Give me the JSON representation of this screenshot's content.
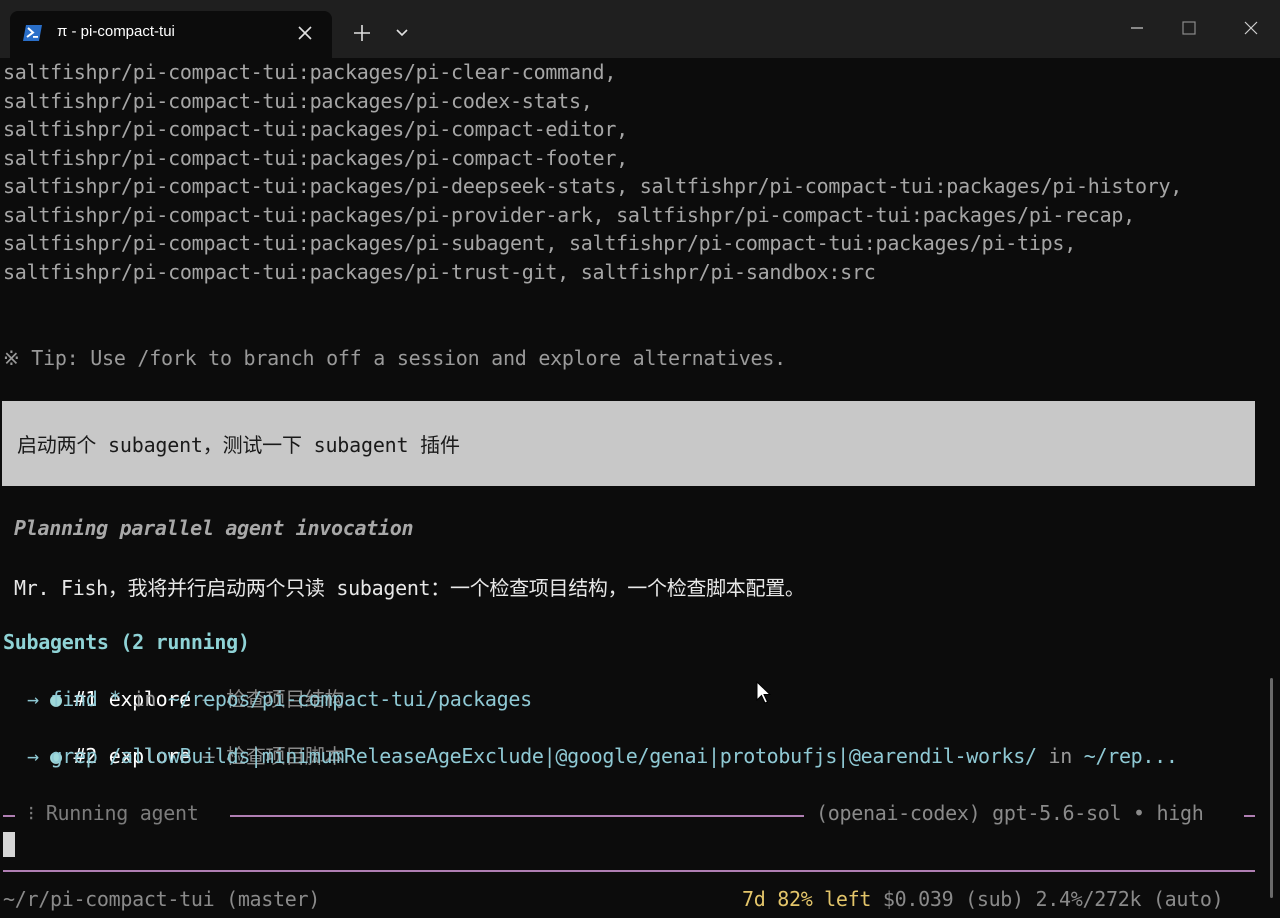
{
  "window": {
    "tab_title": "π - pi-compact-tui",
    "icons": {
      "tab": "powershell-icon",
      "close": "close-icon",
      "new_tab": "plus-icon",
      "dropdown": "chevron-down-icon",
      "minimize": "minimize-icon",
      "maximize": "maximize-icon",
      "window_close": "window-close-icon"
    }
  },
  "output_lines": [
    "saltfishpr/pi-compact-tui:packages/pi-clear-command,",
    "saltfishpr/pi-compact-tui:packages/pi-codex-stats,",
    "saltfishpr/pi-compact-tui:packages/pi-compact-editor,",
    "saltfishpr/pi-compact-tui:packages/pi-compact-footer,",
    "saltfishpr/pi-compact-tui:packages/pi-deepseek-stats, saltfishpr/pi-compact-tui:packages/pi-history,",
    "saltfishpr/pi-compact-tui:packages/pi-provider-ark, saltfishpr/pi-compact-tui:packages/pi-recap,",
    "saltfishpr/pi-compact-tui:packages/pi-subagent, saltfishpr/pi-compact-tui:packages/pi-tips,",
    "saltfishpr/pi-compact-tui:packages/pi-trust-git, saltfishpr/pi-sandbox:src"
  ],
  "tip": "※ Tip: Use /fork to branch off a session and explore alternatives.",
  "user_message": "启动两个 subagent，测试一下 subagent 插件",
  "thinking": "Planning parallel agent invocation",
  "assistant_reply": "Mr. Fish，我将并行启动两个只读 subagent：一个检查项目结构，一个检查脚本配置。",
  "subagents": {
    "header": "Subagents (2 running)",
    "items": [
      {
        "bullet": "●",
        "num": "#1",
        "type": "explore",
        "desc": " — 检查项目结构",
        "arrow": "→ ",
        "cmd": "find * ",
        "cmd_in": "in ",
        "cmd_path": "~/repos/pi-compact-tui/packages"
      },
      {
        "bullet": "●",
        "num": "#2",
        "type": "explore",
        "desc": " — 检查项目脚本",
        "arrow": "→ ",
        "cmd": "grep /allowBuilds|minimumReleaseAgeExclude|@google/genai|protobufjs|@earendil-works/ ",
        "cmd_in": "in ",
        "cmd_path": "~/rep..."
      }
    ]
  },
  "status": {
    "spinner": "⁝",
    "running_label": "Running agent",
    "model": "(openai-codex) gpt-5.6-sol • high"
  },
  "footer": {
    "cwd": "~/r/pi-compact-tui (master)",
    "usage": "7d 82% left",
    "cost": " $0.039 (sub) 2.4%/272k (auto)"
  },
  "colors": {
    "accent_cyan": "#8fd3d6",
    "rule_purple": "#b07fb3",
    "usage_yellow": "#e3c56a"
  }
}
